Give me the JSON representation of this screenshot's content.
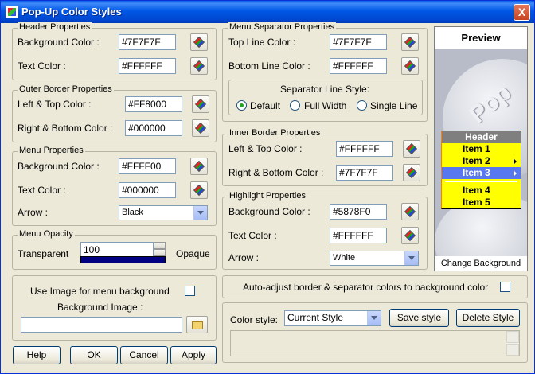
{
  "window": {
    "title": "Pop-Up Color Styles",
    "close_label": "X"
  },
  "header_props": {
    "legend": "Header Properties",
    "bg_label": "Background Color :",
    "bg_value": "#7F7F7F",
    "text_label": "Text Color :",
    "text_value": "#FFFFFF"
  },
  "outer_border": {
    "legend": "Outer Border Properties",
    "lt_label": "Left & Top Color :",
    "lt_value": "#FF8000",
    "rb_label": "Right & Bottom Color :",
    "rb_value": "#000000"
  },
  "menu_props": {
    "legend": "Menu Properties",
    "bg_label": "Background Color :",
    "bg_value": "#FFFF00",
    "text_label": "Text Color :",
    "text_value": "#000000",
    "arrow_label": "Arrow :",
    "arrow_value": "Black"
  },
  "menu_opacity": {
    "legend": "Menu Opacity",
    "left_label": "Transparent",
    "value": "100",
    "right_label": "Opaque",
    "level": 1.0
  },
  "separator_props": {
    "legend": "Menu Separator Properties",
    "top_label": "Top Line Color :",
    "top_value": "#7F7F7F",
    "bottom_label": "Bottom Line Color :",
    "bottom_value": "#FFFFFF",
    "style_label": "Separator Line Style:",
    "options": [
      "Default",
      "Full Width",
      "Single Line"
    ],
    "selected": "Default"
  },
  "inner_border": {
    "legend": "Inner Border Properties",
    "lt_label": "Left & Top Color :",
    "lt_value": "#FFFFFF",
    "rb_label": "Right & Bottom Color :",
    "rb_value": "#7F7F7F"
  },
  "highlight_props": {
    "legend": "Highlight Properties",
    "bg_label": "Background Color :",
    "bg_value": "#5878F0",
    "text_label": "Text Color :",
    "text_value": "#FFFFFF",
    "arrow_label": "Arrow :",
    "arrow_value": "White"
  },
  "preview": {
    "title": "Preview",
    "watermark": "Pop",
    "change_bg_label": "Change Background",
    "menu": {
      "header": "Header",
      "items": [
        "Item 1",
        "Item 2",
        "Item 3",
        "Item 4",
        "Item 5"
      ]
    }
  },
  "image_bg": {
    "use_label": "Use Image for menu background",
    "bg_image_label": "Background Image :",
    "bg_image_value": ""
  },
  "auto_adjust": {
    "label": "Auto-adjust border & separator colors to background color"
  },
  "style": {
    "label": "Color style:",
    "value": "Current Style",
    "save_label": "Save style",
    "delete_label": "Delete Style"
  },
  "buttons": {
    "help": "Help",
    "ok": "OK",
    "cancel": "Cancel",
    "apply": "Apply"
  },
  "colors": {
    "title_bar": "#0058E6",
    "dialog_bg": "#ECE9D8",
    "menu_bg": "#FFFF00",
    "menu_header_bg": "#7F7F7F",
    "highlight_bg": "#5878F0",
    "outer_border": "#FF8000"
  },
  "icons": {
    "color_picker": "color-picker-icon",
    "folder": "folder-icon",
    "app": "app-icon"
  }
}
